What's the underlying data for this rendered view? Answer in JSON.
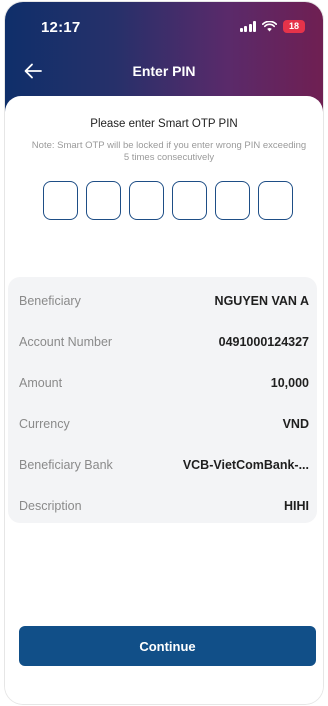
{
  "status_bar": {
    "time": "12:17",
    "battery": "18"
  },
  "nav": {
    "title": "Enter PIN",
    "back_icon": "arrow-left-icon"
  },
  "pin": {
    "title": "Please enter Smart OTP PIN",
    "note": "Note: Smart OTP will be locked if you enter wrong PIN exceeding 5 times consecutively",
    "digits": [
      "",
      "",
      "",
      "",
      "",
      ""
    ]
  },
  "details": [
    {
      "label": "Beneficiary",
      "value": "NGUYEN VAN A"
    },
    {
      "label": "Account Number",
      "value": "0491000124327"
    },
    {
      "label": "Amount",
      "value": "10,000"
    },
    {
      "label": "Currency",
      "value": "VND"
    },
    {
      "label": "Beneficiary Bank",
      "value": "VCB-VietComBank-..."
    },
    {
      "label": "Description",
      "value": "HIHI"
    }
  ],
  "actions": {
    "continue_label": "Continue"
  },
  "colors": {
    "header_gradient_start": "#0f2f6a",
    "header_gradient_end": "#6f1f52",
    "primary": "#114f88",
    "pin_border": "#1e4e86",
    "battery": "#e5334a",
    "card_background": "#f3f4f6"
  }
}
